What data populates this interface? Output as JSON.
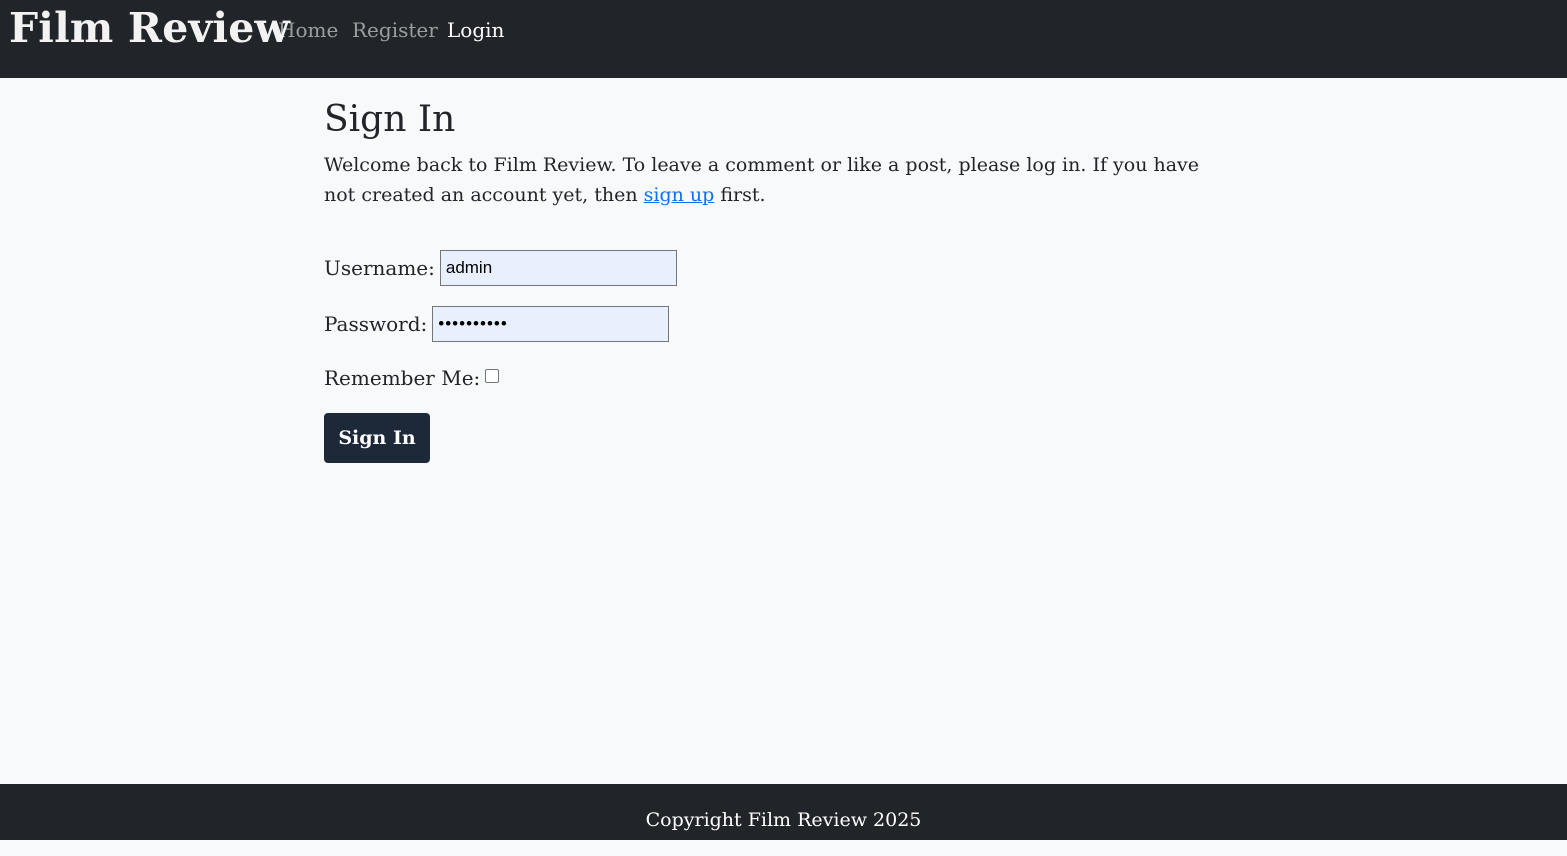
{
  "navbar": {
    "brand": "Film Review",
    "links": [
      {
        "label": "Home"
      },
      {
        "label": "Register"
      },
      {
        "label": "Login"
      }
    ]
  },
  "main": {
    "title": "Sign In",
    "intro_before": "Welcome back to Film Review. To leave a comment or like a post, please log in. If you have not created an account yet, then ",
    "intro_link": "sign up",
    "intro_after": " first."
  },
  "form": {
    "username_label": "Username:",
    "username_value": "admin",
    "password_label": "Password:",
    "password_value": "••••••••••",
    "remember_label": "Remember Me:",
    "remember_checked": false,
    "submit_label": "Sign In"
  },
  "footer": {
    "text": "Copyright Film Review 2025"
  },
  "colors": {
    "navbar_bg": "#212529",
    "page_bg": "#f8f9fa",
    "link": "#0d6efd",
    "button_bg": "#1d2939",
    "autofill_bg": "#e8f0fe"
  }
}
